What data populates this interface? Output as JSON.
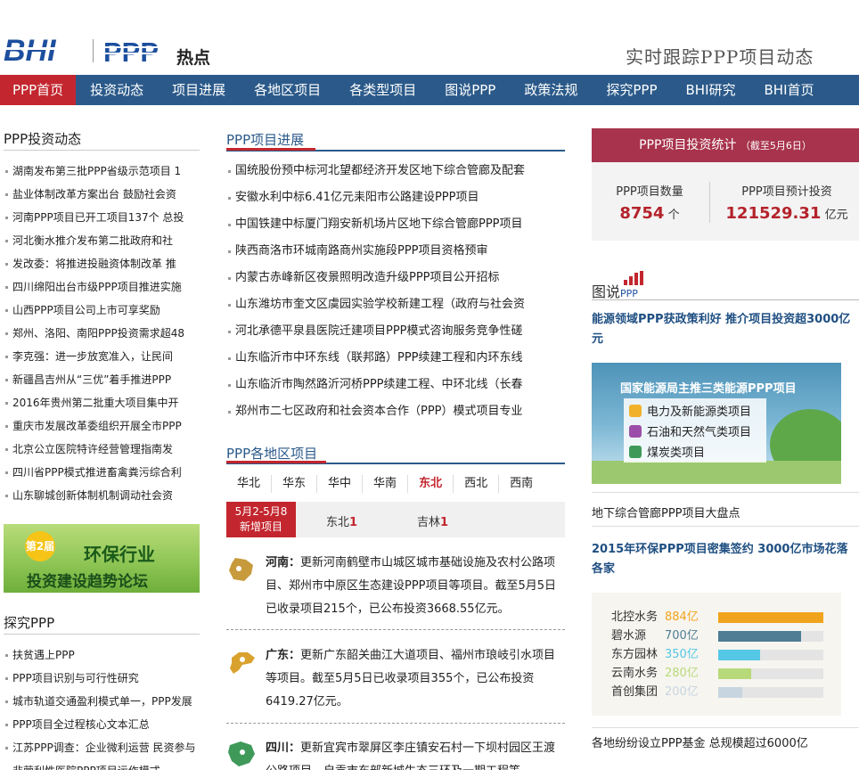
{
  "header": {
    "hot_label": "热点",
    "slogan": "实时跟踪PPP项目动态",
    "logo_bhi_text": "BHI",
    "logo_ppp_text": "PPP"
  },
  "nav": [
    "PPP首页",
    "投资动态",
    "项目进展",
    "各地区项目",
    "各类型项目",
    "图说PPP",
    "政策法规",
    "探究PPP",
    "BHI研究",
    "BHI首页"
  ],
  "left": {
    "invest_title": "PPP投资动态",
    "invest_items": [
      "湖南发布第三批PPP省级示范项目 1",
      "盐业体制改革方案出台 鼓励社会资",
      "河南PPP项目已开工项目137个 总投",
      "河北衡水推介发布第二批政府和社",
      "发改委：将推进投融资体制改革 推",
      "四川绵阳出台市级PPP项目推进实施",
      "山西PPP项目公司上市可享奖励",
      "郑州、洛阳、南阳PPP投资需求超48",
      "李克强：进一步放宽准入，让民间",
      "新疆昌吉州从“三优”着手推进PPP",
      "2016年贵州第二批重大项目集中开",
      "重庆市发展改革委组织开展全市PPP",
      "北京公立医院特许经营管理指南发",
      "四川省PPP模式推进畜禽粪污综合利",
      "山东聊城创新体制机制调动社会资"
    ],
    "banner_badge": "第2届",
    "banner_line1": "环保行业",
    "banner_line2": "投资建设趋势论坛",
    "explore_title": "探究PPP",
    "explore_items": [
      "扶贫遇上PPP",
      "PPP项目识别与可行性研究",
      "城市轨道交通盈利模式单一，PPP发展",
      "PPP项目全过程核心文本汇总",
      "江苏PPP调查：企业微利运营 民资参与",
      "非营利性医院PPP项目运作模式"
    ]
  },
  "middle": {
    "progress_title": "PPP项目进展",
    "progress_items": [
      "国统股份预中标河北望都经济开发区地下综合管廊及配套",
      "安徽水利中标6.41亿元耒阳市公路建设PPP项目",
      "中国铁建中标厦门翔安新机场片区地下综合管廊PPP项目",
      "陕西商洛市环城南路商州实施段PPP项目资格预审",
      "内蒙古赤峰新区夜景照明改造升级PPP项目公开招标",
      "山东潍坊市奎文区虞园实验学校新建工程（政府与社会资",
      "河北承德平泉县医院迁建项目PPP模式咨询服务竞争性磋",
      "山东临沂市中环东线（联邦路）PPP续建工程和内环东线",
      "山东临沂市陶然路沂河桥PPP续建工程、中环北线（长春",
      "郑州市二七区政府和社会资本合作（PPP）模式项目专业"
    ],
    "region_title": "PPP各地区项目",
    "regions": [
      "华北",
      "华东",
      "华中",
      "华南",
      "东北",
      "西北",
      "西南"
    ],
    "selected_region": "东北",
    "new_label_dates": "5月2-5月8",
    "new_label": "新增项目",
    "new_counts": [
      {
        "name": "东北",
        "count": "1"
      },
      {
        "name": "吉林",
        "count": "1"
      }
    ],
    "news": [
      {
        "province": "河南：",
        "text": "更新河南鹤壁市山城区城市基础设施及农村公路项目、郑州市中原区生态建设PPP项目等项目。截至5月5日已收录项目215个，已公布投资3668.55亿元。"
      },
      {
        "province": "广东：",
        "text": "更新广东韶关曲江大道项目、福州市琅岐引水项目等项目。截至5月5日已收录项目355个，已公布投资6419.27亿元。"
      },
      {
        "province": "四川：",
        "text": "更新宜宾市翠屏区李庄镇安石村一下坝村园区王渡公路项目、自贡市东部新城生态三环及一期工程等"
      }
    ]
  },
  "right": {
    "stat_title": "PPP项目投资统计",
    "stat_note": "（截至5月6日）",
    "count_label": "PPP项目数量",
    "count_value": "8754",
    "count_unit": "个",
    "invest_label": "PPP项目预计投资",
    "invest_value": "121529.31",
    "invest_unit": "亿元",
    "tushuo_title": "图说",
    "tushuo_sub": "PPP",
    "headline1": "能源领域PPP获政策利好 推介项目投资超3000亿元",
    "energy_title": "国家能源局主推三类能源PPP项目",
    "energy_items": [
      "电力及新能源类项目",
      "石油和天然气类项目",
      "煤炭类项目"
    ],
    "link1": "地下综合管廊PPP项目大盘点",
    "headline2": "2015年环保PPP项目密集签约 3000亿市场花落各家",
    "bars": [
      {
        "name": "北控水务",
        "label": "884亿",
        "value": 884,
        "color": "#f0a41e"
      },
      {
        "name": "碧水源",
        "label": "700亿",
        "value": 700,
        "color": "#4e7d94"
      },
      {
        "name": "东方园林",
        "label": "350亿",
        "value": 350,
        "color": "#55c8e6"
      },
      {
        "name": "云南水务",
        "label": "280亿",
        "value": 280,
        "color": "#b7d97a"
      },
      {
        "name": "首创集团",
        "label": "200亿",
        "value": 200,
        "color": "#c7d5e0"
      }
    ],
    "link2": "各地纷纷设立PPP基金 总规模超过6000亿"
  }
}
